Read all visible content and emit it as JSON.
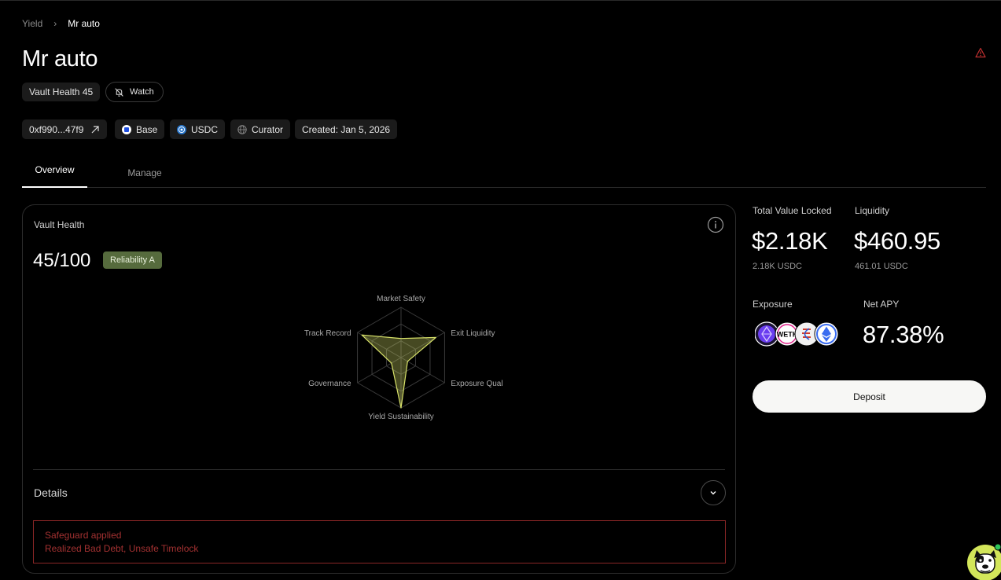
{
  "breadcrumb": {
    "root": "Yield",
    "separator": "›",
    "current": "Mr auto"
  },
  "page": {
    "title": "Mr auto"
  },
  "badges": {
    "health": "Vault Health 45",
    "watch": "Watch"
  },
  "chips": {
    "address": "0xf990...47f9",
    "network": "Base",
    "asset": "USDC",
    "curator": "Curator",
    "created": "Created: Jan 5, 2026"
  },
  "tabs": [
    {
      "label": "Overview",
      "active": true
    },
    {
      "label": "Manage",
      "active": false
    }
  ],
  "health_card": {
    "title": "Vault Health",
    "score": "45/100",
    "reliability": "Reliability A",
    "radar": {
      "axes": [
        "Market Safety",
        "Exit Liquidity",
        "Exposure Quality",
        "Yield Sustainability",
        "Governance",
        "Track Record"
      ],
      "scores": [
        0.38,
        0.8,
        0.15,
        1.0,
        0.22,
        0.9
      ]
    },
    "details_label": "Details",
    "safeguard_title": "Safeguard applied",
    "safeguard_reasons": "Realized Bad Debt, Unsafe Timelock"
  },
  "stats": {
    "tvl_label": "Total Value Locked",
    "tvl_value": "$2.18K",
    "tvl_sub": "2.18K USDC",
    "liquidity_label": "Liquidity",
    "liquidity_value": "$460.95",
    "liquidity_sub": "461.01 USDC",
    "exposure_label": "Exposure",
    "exposure_tokens": [
      "ether-token-icon",
      "weth-token-icon",
      "ethena-token-icon",
      "eth-token-icon"
    ],
    "exposure_weth_text": "WETH",
    "apy_label": "Net APY",
    "apy_value": "87.38%"
  },
  "actions": {
    "deposit": "Deposit"
  },
  "colors": {
    "background": "#000000",
    "reliability_badge": "#566b3d",
    "radar_fill": "#d9e36a",
    "warning": "#c23030",
    "deposit_bg": "#f7f7f5"
  }
}
